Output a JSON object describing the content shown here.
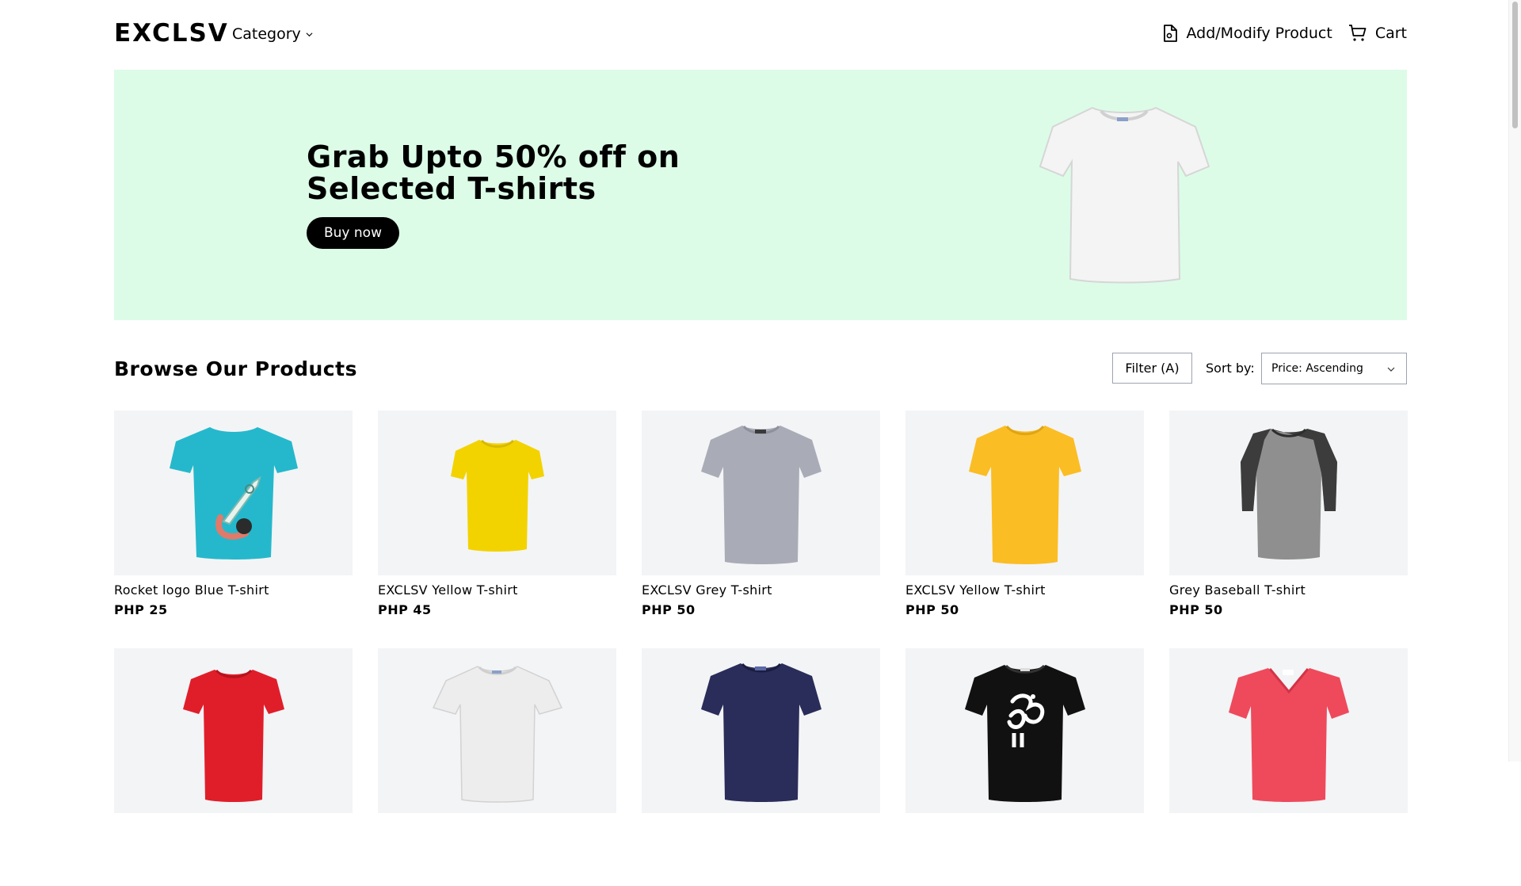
{
  "header": {
    "brand": "EXCLSV",
    "category_label": "Category",
    "add_modify_label": "Add/Modify Product",
    "cart_label": "Cart"
  },
  "hero": {
    "title": "Grab Upto 50% off on Selected T-shirts",
    "button_label": "Buy now",
    "background_color": "#dcfce7"
  },
  "browse": {
    "title": "Browse Our Products",
    "filter_label": "Filter (A)",
    "sort_label": "Sort by:",
    "sort_value": "Price: Ascending"
  },
  "products": [
    {
      "name": "Rocket logo Blue T-shirt",
      "price": "PHP 25",
      "color": "#25b8cc",
      "icon": "rocket-tshirt"
    },
    {
      "name": "EXCLSV Yellow T-shirt",
      "price": "PHP 45",
      "color": "#f2d300",
      "icon": "tshirt"
    },
    {
      "name": "EXCLSV Grey T-shirt",
      "price": "PHP 50",
      "color": "#a9acb6",
      "icon": "tshirt"
    },
    {
      "name": "EXCLSV Yellow T-shirt",
      "price": "PHP 50",
      "color": "#fbbd24",
      "icon": "tshirt"
    },
    {
      "name": "Grey Baseball T-shirt",
      "price": "PHP 50",
      "color": "#8f8f8f",
      "icon": "raglan-tshirt"
    },
    {
      "name": "",
      "price": "",
      "color": "#e01e2a",
      "icon": "tshirt"
    },
    {
      "name": "",
      "price": "",
      "color": "#ececec",
      "icon": "tshirt"
    },
    {
      "name": "",
      "price": "",
      "color": "#2a2d5a",
      "icon": "tshirt"
    },
    {
      "name": "",
      "price": "",
      "color": "#111111",
      "icon": "om-tshirt"
    },
    {
      "name": "",
      "price": "",
      "color": "#ee4a5c",
      "icon": "vneck-tshirt"
    }
  ]
}
